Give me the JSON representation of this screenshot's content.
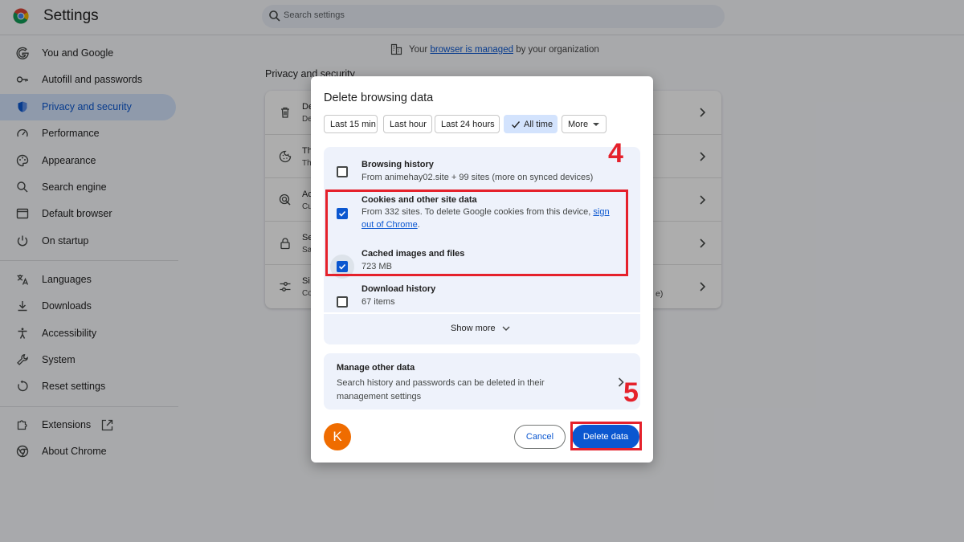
{
  "header": {
    "title": "Settings",
    "search_placeholder": "Search settings"
  },
  "sidebar": {
    "items": [
      {
        "label": "You and Google",
        "icon": "google-g-icon"
      },
      {
        "label": "Autofill and passwords",
        "icon": "key-icon"
      },
      {
        "label": "Privacy and security",
        "icon": "shield-icon",
        "active": true
      },
      {
        "label": "Performance",
        "icon": "speedometer-icon"
      },
      {
        "label": "Appearance",
        "icon": "palette-icon"
      },
      {
        "label": "Search engine",
        "icon": "search-icon"
      },
      {
        "label": "Default browser",
        "icon": "browser-window-icon"
      },
      {
        "label": "On startup",
        "icon": "power-icon"
      },
      {
        "label": "Languages",
        "icon": "translate-icon"
      },
      {
        "label": "Downloads",
        "icon": "download-icon"
      },
      {
        "label": "Accessibility",
        "icon": "accessibility-icon"
      },
      {
        "label": "System",
        "icon": "wrench-icon"
      },
      {
        "label": "Reset settings",
        "icon": "reset-icon"
      },
      {
        "label": "Extensions",
        "icon": "puzzle-icon"
      },
      {
        "label": "About Chrome",
        "icon": "chrome-icon"
      }
    ]
  },
  "main": {
    "managed_prefix": "Your ",
    "managed_link": "browser is managed",
    "managed_suffix": " by your organization",
    "section_title": "Privacy and security",
    "card_rows": [
      {
        "title": "De",
        "sub": "De",
        "icon": "trash-icon"
      },
      {
        "title": "Th",
        "sub": "Th",
        "icon": "cookie-icon"
      },
      {
        "title": "Ac",
        "sub": "Cu",
        "icon": "ad-privacy-icon"
      },
      {
        "title": "Se",
        "sub": "Sa",
        "icon": "lock-icon"
      },
      {
        "title": "Si",
        "sub": "Co",
        "icon": "sliders-icon",
        "tail": "e)"
      }
    ]
  },
  "dialog": {
    "title": "Delete browsing data",
    "time_ranges": [
      "Last 15 min",
      "Last hour",
      "Last 24 hours",
      "All time",
      "More"
    ],
    "selected_range": "All time",
    "items": [
      {
        "title": "Browsing history",
        "subtitle": "From animehay02.site + 99 sites (more on synced devices)",
        "checked": false
      },
      {
        "title": "Cookies and other site data",
        "subtitle_line1_prefix": "From 332 sites. To delete Google cookies from this device, ",
        "subtitle_link_part1": "sign",
        "subtitle_link_part2": "out of Chrome",
        "subtitle_line2_suffix": ".",
        "checked": true
      },
      {
        "title": "Cached images and files",
        "subtitle": "723 MB",
        "checked": true
      },
      {
        "title": "Download history",
        "subtitle": "67 items",
        "checked": false
      }
    ],
    "show_more": "Show more",
    "manage_title": "Manage other data",
    "manage_subtitle": "Search history and passwords can be deleted in their management settings",
    "avatar_letter": "K",
    "cancel_label": "Cancel",
    "delete_label": "Delete data"
  },
  "annotations": {
    "step_four": "4",
    "step_five": "5",
    "color": "#e5212b"
  },
  "colors": {
    "accent": "#0b57d0",
    "active_nav_bg": "#d3e3fd",
    "avatar_bg": "#ef6c00"
  }
}
